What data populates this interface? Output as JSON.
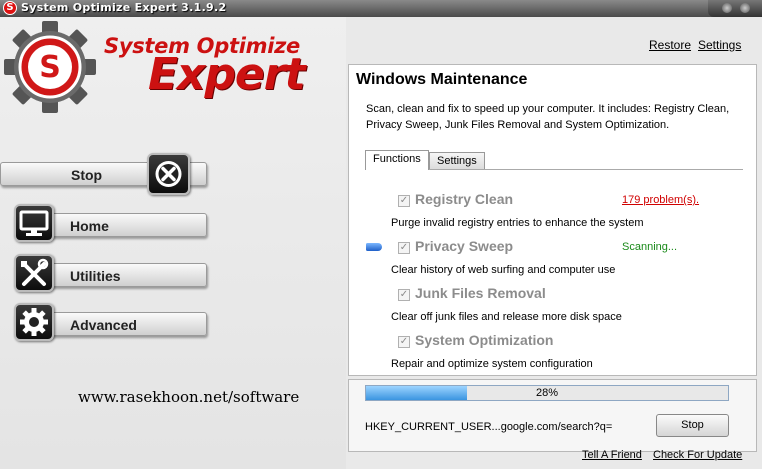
{
  "window": {
    "title": "System Optimize Expert  3.1.9.2"
  },
  "logo": {
    "line1": "System Optimize",
    "line2": "Expert",
    "badge_letter": "S"
  },
  "nav": {
    "stop": "Stop",
    "home": "Home",
    "utilities": "Utilities",
    "advanced": "Advanced"
  },
  "website": "www.rasekhoon.net/software",
  "header_links": {
    "restore": "Restore",
    "settings": "Settings"
  },
  "main": {
    "title": "Windows Maintenance",
    "description": "Scan, clean and fix to speed up your computer. It includes: Registry Clean, Privacy Sweep, Junk Files Removal and System Optimization.",
    "tabs": [
      {
        "label": "Functions",
        "active": true
      },
      {
        "label": "Settings",
        "active": false
      }
    ],
    "tasks": [
      {
        "name": "Registry Clean",
        "description": "Purge invalid registry entries to enhance the system",
        "checked": true,
        "status": "179 problem(s).",
        "status_color": "#d00000"
      },
      {
        "name": "Privacy Sweep",
        "description": "Clear history of web surfing and computer use",
        "checked": true,
        "status": "Scanning...",
        "status_color": "#1a8a1a",
        "current": true
      },
      {
        "name": "Junk Files Removal",
        "description": "Clear off junk files and release more disk space",
        "checked": true,
        "status": ""
      },
      {
        "name": "System Optimization",
        "description": "Repair and optimize system configuration",
        "checked": true,
        "status": ""
      }
    ]
  },
  "scan": {
    "progress_percent": 28,
    "progress_label": "28%",
    "current_item": "HKEY_CURRENT_USER...google.com/search?q=",
    "stop_label": "Stop"
  },
  "footer": {
    "tell_friend": "Tell A Friend",
    "check_update": "Check For Update"
  },
  "colors": {
    "brand_red": "#cc1111",
    "problem_red": "#d00000",
    "scanning_green": "#1a8a1a",
    "progress_blue": "#3a95e0"
  }
}
